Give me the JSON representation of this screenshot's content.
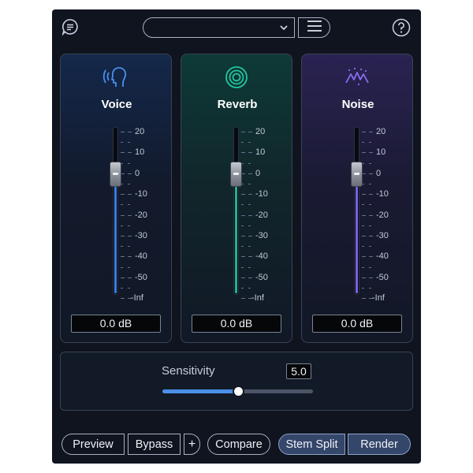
{
  "topbar": {
    "chat_icon": "chat-bubble-icon",
    "preset": {
      "value": "",
      "icon": "chevron-down-icon"
    },
    "menu_icon": "hamburger-menu-icon",
    "help_icon": "question-mark-icon"
  },
  "channels": [
    {
      "name": "Voice",
      "icon": "voice-head-icon",
      "value_db": "0.0 dB",
      "fader_level_db": 0,
      "fill_color": "#3d7be8"
    },
    {
      "name": "Reverb",
      "icon": "reverb-rings-icon",
      "value_db": "0.0 dB",
      "fader_level_db": 0,
      "fill_color": "#1fb391"
    },
    {
      "name": "Noise",
      "icon": "noise-wave-icon",
      "value_db": "0.0 dB",
      "fader_level_db": 0,
      "fill_color": "#7b5fe6"
    }
  ],
  "scale": [
    "20",
    "10",
    "0",
    "-10",
    "-20",
    "-30",
    "-40",
    "-50",
    "-Inf"
  ],
  "sensitivity": {
    "label": "Sensitivity",
    "value": "5.0",
    "fraction": 0.5
  },
  "buttons": {
    "preview": "Preview",
    "bypass": "Bypass",
    "plus": "+",
    "compare": "Compare",
    "stem_split": "Stem Split",
    "render": "Render"
  },
  "colors": {
    "voice_accent": "#3d7be8",
    "reverb_accent": "#1fb391",
    "noise_accent": "#7b5fe6",
    "slider_accent": "#4a8fe8"
  }
}
